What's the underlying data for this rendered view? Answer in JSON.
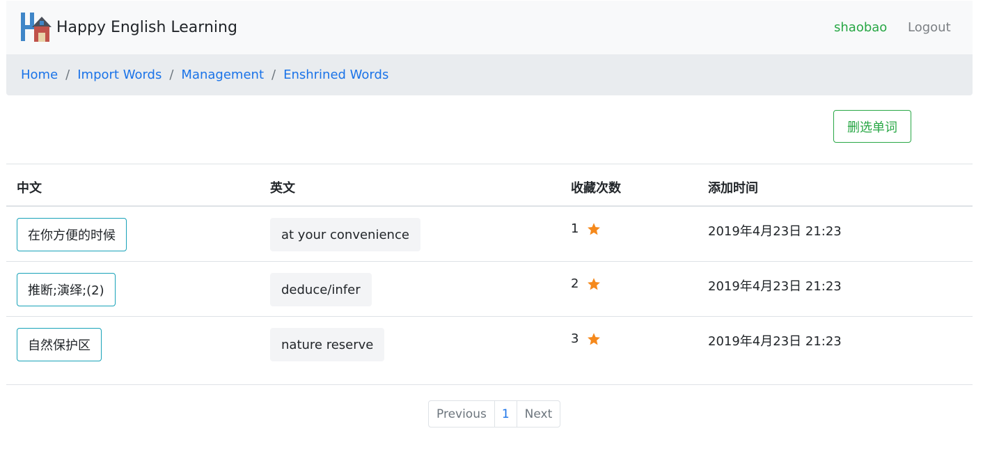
{
  "navbar": {
    "brand": "Happy English Learning",
    "logo_icon": "house-letter-h-icon",
    "user": "shaobao",
    "logout": "Logout"
  },
  "breadcrumb": [
    "Home",
    "Import Words",
    "Management",
    "Enshrined Words"
  ],
  "actions": {
    "delete_label": "删选单词"
  },
  "table": {
    "headers": [
      "中文",
      "英文",
      "收藏次数",
      "添加时间"
    ],
    "rows": [
      {
        "cn": "在你方便的时候",
        "en": "at your convenience",
        "count": "1",
        "date": "2019年4月23日 21:23"
      },
      {
        "cn": "推断;演绎;(2)",
        "en": "deduce/infer",
        "count": "2",
        "date": "2019年4月23日 21:23"
      },
      {
        "cn": "自然保护区",
        "en": "nature reserve",
        "count": "3",
        "date": "2019年4月23日 21:23"
      }
    ]
  },
  "pagination": {
    "prev": "Previous",
    "page": "1",
    "next": "Next"
  },
  "colors": {
    "accent_green": "#28a745",
    "link_blue": "#1a73e8",
    "star": "#f5891c",
    "cn_border": "#17a2b8"
  }
}
